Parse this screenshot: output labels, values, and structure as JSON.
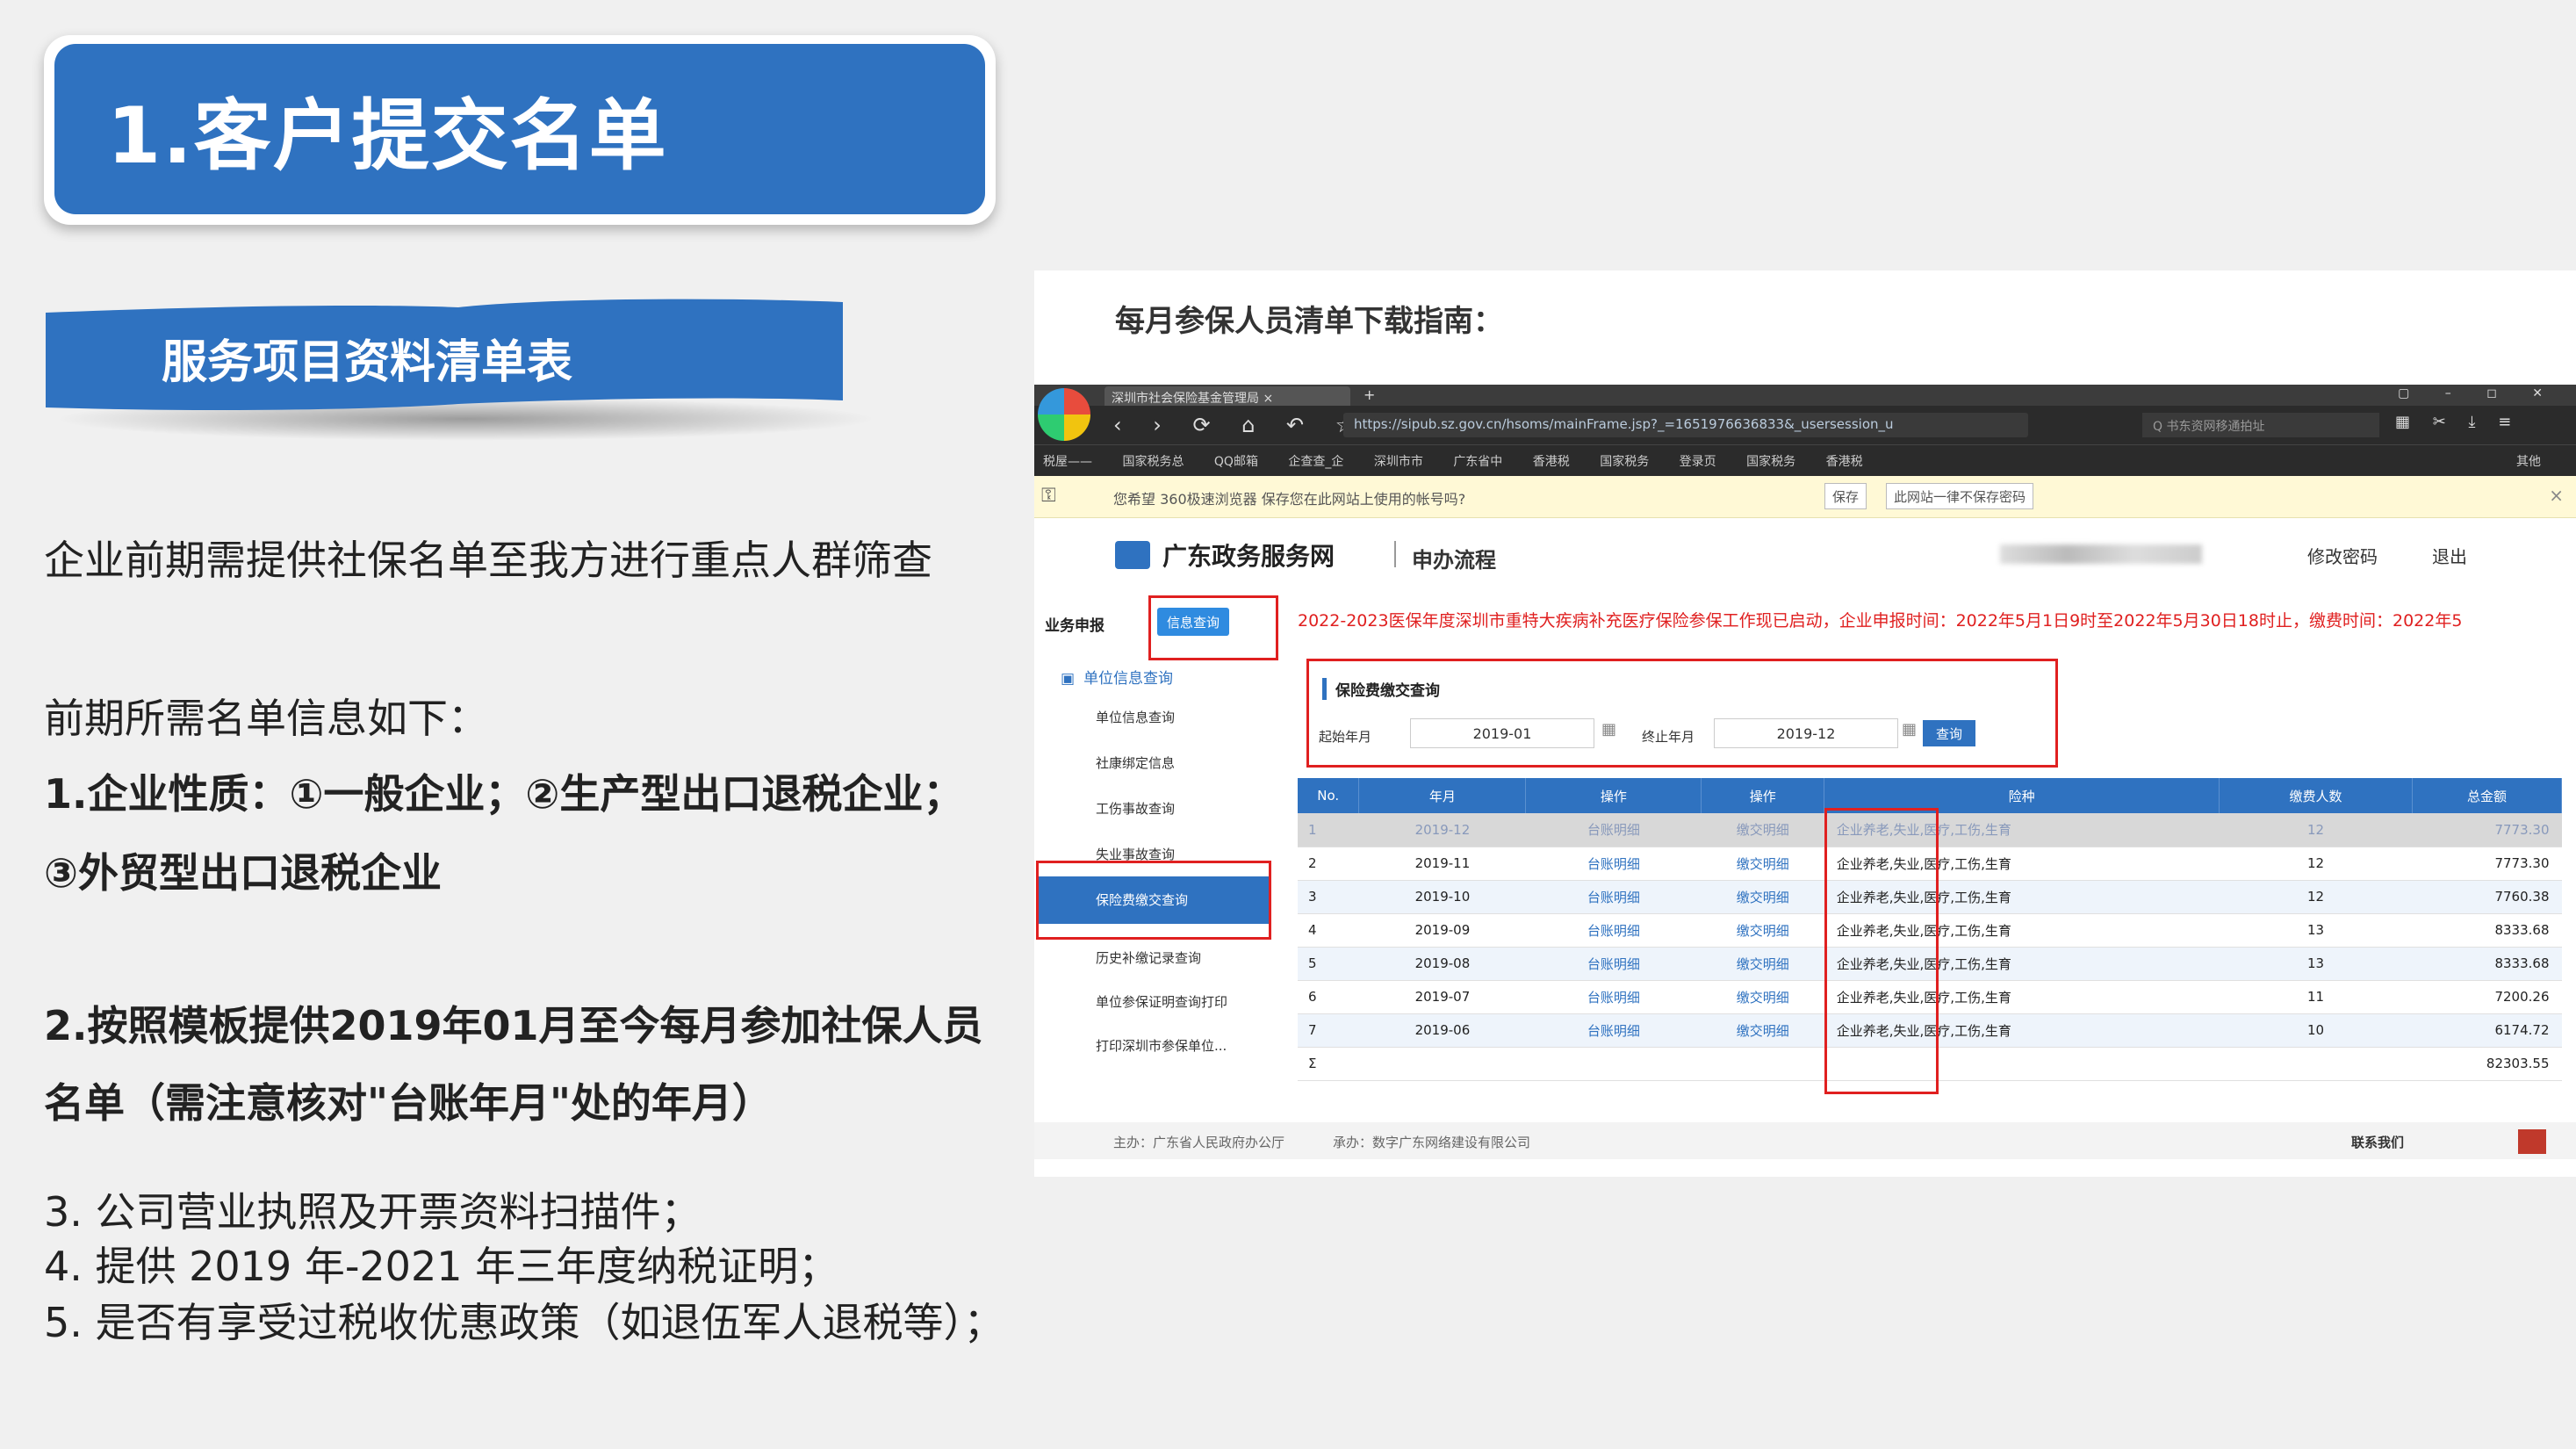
{
  "slide": {
    "title": "1.客户提交名单",
    "subtitle": "服务项目资料清单表",
    "intro": "企业前期需提供社保名单至我方进行重点人群筛查",
    "needs_heading": "前期所需名单信息如下：",
    "item1_line1": "1.企业性质：①一般企业；②生产型出口退税企业；",
    "item1_line2": "③外贸型出口退税企业",
    "item2_line1": "2.按照模板提供2019年01月至今每月参加社保人员",
    "item2_line2": "名单（需注意核对\"台账年月\"处的年月）",
    "item3": "3. 公司营业执照及开票资料扫描件；",
    "item4": "4. 提供 2019 年-2021 年三年度纳税证明；",
    "item5": "5. 是否有享受过税收优惠政策（如退伍军人退税等）；",
    "accent_color": "#2f72c0"
  },
  "screenshot": {
    "guide_title": "每月参保人员清单下载指南：",
    "browser": {
      "tab_title": "深圳市社会保险基金管理局 ×",
      "tab_plus": "+",
      "window_controls": "▢ – ◻ ✕",
      "nav_buttons": "‹ › ⟳ ⌂ ↶ ☆",
      "url": "https://sipub.sz.gov.cn/hsoms/mainFrame.jsp?_=1651976636833&_usersession_u",
      "search_placeholder": "Q 书东资网移通拍址",
      "tools": "▦ ✂ ⤓ ≡",
      "bookmarks": [
        "税屋——",
        "国家税务总",
        "QQ邮箱",
        "企查查_企",
        "深圳市市",
        "广东省中",
        "香港税",
        "国家税务",
        "登录页",
        "国家税务",
        "香港税"
      ],
      "bookmarks_right": "其他"
    },
    "password_bar": {
      "icon": "key-icon",
      "message": "您希望 360极速浏览器 保存您在此网站上使用的帐号吗?",
      "save_button": "保存",
      "never_button": "此网站一律不保存密码",
      "close": "×"
    },
    "site": {
      "name": "广东政务服务网",
      "flow": "申办流程",
      "change_password": "修改密码",
      "logout": "退出"
    },
    "sidebar": {
      "business_label": "业务申报",
      "query_button": "信息查询",
      "unit_query": "单位信息查询",
      "items": [
        "单位信息查询",
        "社康绑定信息",
        "工伤事故查询",
        "失业事故查询",
        "历史补缴记录查询",
        "单位参保证明查询打印",
        "打印深圳市参保单位..."
      ],
      "active_item": "保险费缴交查询"
    },
    "notice": "2022-2023医保年度深圳市重特大疾病补充医疗保险参保工作现已启动，企业申报时间：2022年5月1日9时至2022年5月30日18时止，缴费时间：2022年5",
    "query": {
      "title": "保险费缴交查询",
      "start_label": "起始年月",
      "start_value": "2019-01",
      "end_label": "终止年月",
      "end_value": "2019-12",
      "button": "查询"
    },
    "table": {
      "headers": [
        "No.",
        "年月",
        "操作",
        "操作",
        "险种",
        "缴费人数",
        "总金额"
      ],
      "rows": [
        [
          "1",
          "2019-12",
          "台账明细",
          "缴交明细",
          "企业养老,失业,医疗,工伤,生育",
          "12",
          "7773.30"
        ],
        [
          "2",
          "2019-11",
          "台账明细",
          "缴交明细",
          "企业养老,失业,医疗,工伤,生育",
          "12",
          "7773.30"
        ],
        [
          "3",
          "2019-10",
          "台账明细",
          "缴交明细",
          "企业养老,失业,医疗,工伤,生育",
          "12",
          "7760.38"
        ],
        [
          "4",
          "2019-09",
          "台账明细",
          "缴交明细",
          "企业养老,失业,医疗,工伤,生育",
          "13",
          "8333.68"
        ],
        [
          "5",
          "2019-08",
          "台账明细",
          "缴交明细",
          "企业养老,失业,医疗,工伤,生育",
          "13",
          "8333.68"
        ],
        [
          "6",
          "2019-07",
          "台账明细",
          "缴交明细",
          "企业养老,失业,医疗,工伤,生育",
          "11",
          "7200.26"
        ],
        [
          "7",
          "2019-06",
          "台账明细",
          "缴交明细",
          "企业养老,失业,医疗,工伤,生育",
          "10",
          "6174.72"
        ]
      ],
      "sum_label": "Σ",
      "sum_total": "82303.55"
    },
    "footer": {
      "host": "主办：广东省人民政府办公厅",
      "builder": "承办：数字广东网络建设有限公司",
      "contact": "联系我们"
    }
  }
}
